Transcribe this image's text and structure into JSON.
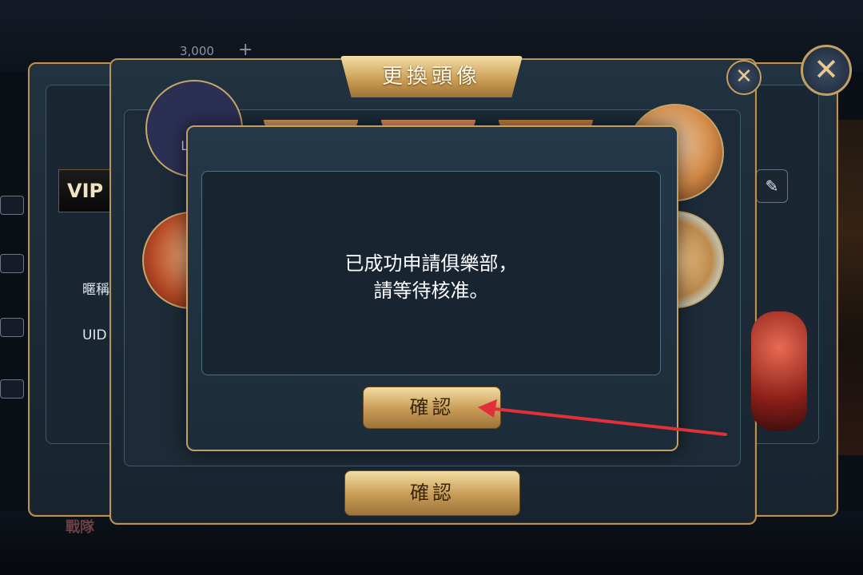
{
  "lobby": {
    "coin_balance": "3,000",
    "vip_label": "VIP",
    "bottom_label": "戰隊"
  },
  "profile_panel": {
    "vip_badge": "VIP",
    "nickname_label": "暱稱",
    "uid_label": "UID",
    "close_icon": "close-icon",
    "edit_icon": "edit-icon"
  },
  "avatar_panel": {
    "title": "更換頭像",
    "default_avatar_text": "山 頭",
    "confirm_label": "確認",
    "close_icon": "close-icon"
  },
  "dialog": {
    "message_line1": "已成功申請俱樂部，",
    "message_line2": "請等待核准。",
    "confirm_label": "確認"
  },
  "annotation": {
    "arrow_color": "#e0303a"
  }
}
